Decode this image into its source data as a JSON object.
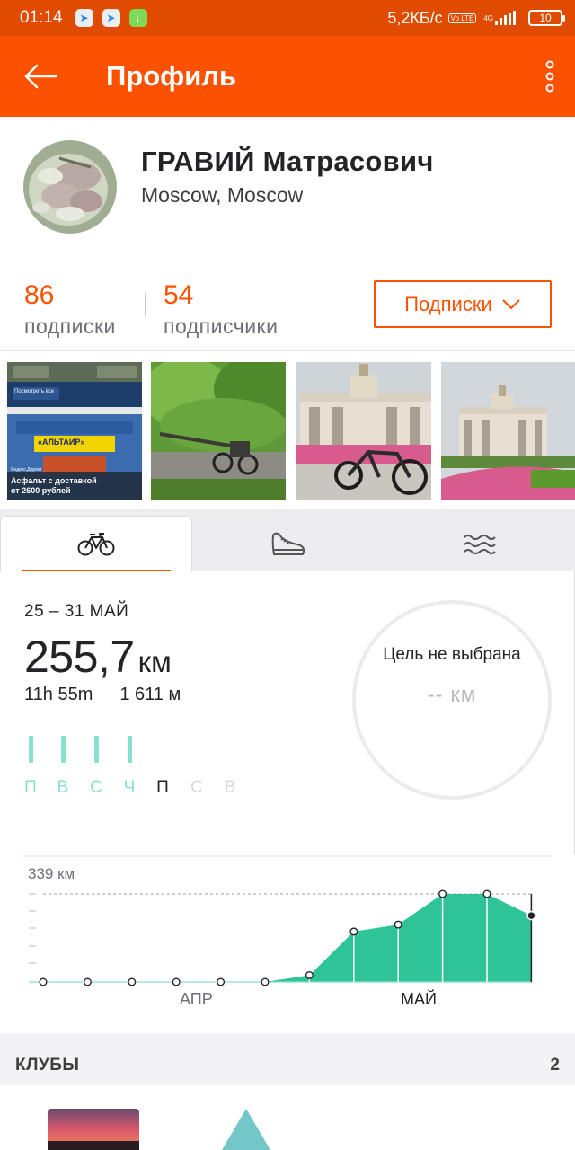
{
  "status_bar": {
    "time": "01:14",
    "network_speed": "5,2КБ/с",
    "volte": "Vo LTE",
    "network_type": "4G",
    "battery": "10"
  },
  "app_bar": {
    "title": "Профиль"
  },
  "profile": {
    "name": "ГРАВИЙ Матрасович",
    "location": "Moscow, Moscow",
    "following_count": "86",
    "following_label": "подписки",
    "followers_count": "54",
    "followers_label": "подписчики",
    "follow_button": "Подписки"
  },
  "photos": [
    {
      "description": "Screenshot of advertisement",
      "ad_button": "Посмотреть все",
      "ad_sign": "«АЛЬТАИР»",
      "ad_source": "Яндекс.Директ",
      "ad_caption": "Асфальт с доставкой от 2600 рублей"
    },
    {
      "description": "Cannon in park"
    },
    {
      "description": "Bicycle in front of arch"
    },
    {
      "description": "Arch with flower beds"
    }
  ],
  "tabs": [
    {
      "name": "ride",
      "icon": "bicycle-icon",
      "active": true
    },
    {
      "name": "run",
      "icon": "shoe-icon",
      "active": false
    },
    {
      "name": "swim",
      "icon": "waves-icon",
      "active": false
    }
  ],
  "weekly": {
    "range": "25 – 31 МАЙ",
    "distance_value": "255,7",
    "distance_unit": "км",
    "time": "11h 55m",
    "elevation": "1 611 м",
    "days": [
      {
        "label": "П",
        "active": true
      },
      {
        "label": "В",
        "active": true
      },
      {
        "label": "С",
        "active": true
      },
      {
        "label": "Ч",
        "active": true
      },
      {
        "label": "П",
        "active": false,
        "current": true
      },
      {
        "label": "С",
        "active": false
      },
      {
        "label": "В",
        "active": false
      }
    ],
    "goal_title": "Цель не выбрана",
    "goal_value": "-- км"
  },
  "colors": {
    "brand": "#fc5200",
    "status_bar": "#e04b00",
    "activity": "#86e0cf",
    "chart_fill": "#2fc498"
  },
  "chart_data": {
    "type": "area",
    "ylabel": "339 км",
    "ylim": [
      0,
      339
    ],
    "x_labels": [
      "АПР",
      "МАЙ"
    ],
    "series": [
      {
        "values": [
          0,
          0,
          0,
          0,
          0,
          0,
          26,
          194,
          221,
          339,
          339,
          255.7
        ]
      }
    ],
    "month_boundary_after_index": 5,
    "current_index": 11
  },
  "clubs": {
    "title": "КЛУБЫ",
    "count": "2"
  }
}
